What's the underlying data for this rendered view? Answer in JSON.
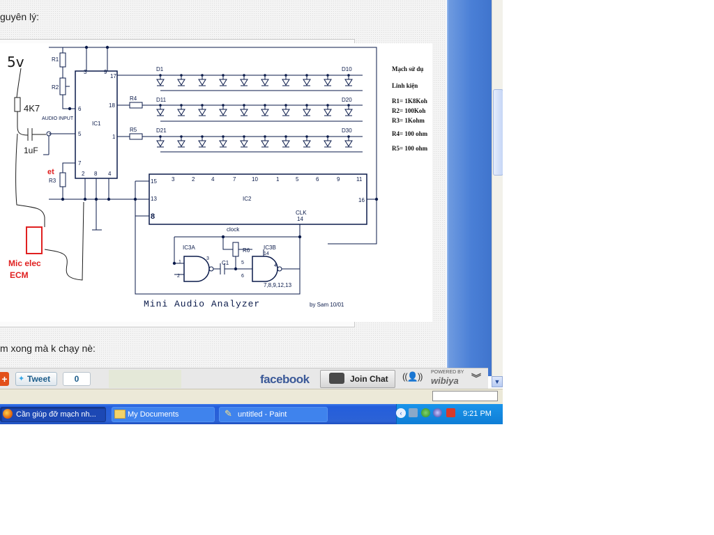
{
  "post": {
    "line1": "guyên lý:",
    "line2": "m xong mà k chạy nè:"
  },
  "schematic": {
    "title": "Mini Audio Analyzer",
    "credit": "by Sam 10/01",
    "ic1": "IC1",
    "ic2": "IC2",
    "ic3a": "IC3A",
    "ic3b": "IC3B",
    "clock_label": "clock",
    "clk_label": "CLK",
    "audio_input": "AUDIO INPUT",
    "resistors": [
      "R1",
      "R2",
      "R3",
      "R4",
      "R5",
      "R6"
    ],
    "c1": "C1",
    "d1": "D1",
    "d10": "D10",
    "d11": "D11",
    "d20": "D20",
    "d21": "D21",
    "d30": "D30",
    "ic1_pins": [
      "3",
      "9",
      "17",
      "6",
      "18",
      "5",
      "1",
      "7",
      "2",
      "8",
      "4"
    ],
    "ic2_pins_top": [
      "3",
      "2",
      "4",
      "7",
      "10",
      "1",
      "5",
      "6",
      "9",
      "11"
    ],
    "ic2_pins_left": [
      "15",
      "13",
      "8"
    ],
    "ic2_pin_right": "16",
    "ic2_pin_clk": "14",
    "ic3_pins": [
      "1",
      "2",
      "3",
      "5",
      "6",
      "4",
      "14",
      "7,8,9,12,13"
    ],
    "hand_5v": "5v",
    "hand_4k7": "4K7",
    "hand_1uf": "1uF",
    "hand_mic_1": "Mic elec",
    "hand_mic_2": "ECM",
    "hand_et": "et"
  },
  "side_notes": {
    "heading": "Mạch sử dụ",
    "parts": "Linh kiện",
    "r1": "R1= 1K8Koh",
    "r2": "R2= 100Koh",
    "r3": "R3= 1Kohm",
    "r4": "R4= 100 ohm",
    "r5": "R5= 100 ohm"
  },
  "share_bar": {
    "tweet": "Tweet",
    "tweet_count": "0",
    "facebook": "facebook",
    "join_chat": "Join Chat",
    "powered_by": "POWERED BY",
    "wibiya": "wibiya"
  },
  "taskbar": {
    "browser_task": "Cần giúp đỡ mạch nh...",
    "docs_task": "My Documents",
    "paint_task": "untitled - Paint",
    "clock": "9:21 PM"
  },
  "colors": {
    "taskbar_blue": "#245edb",
    "facebook_blue": "#3b5998",
    "annotation_red": "#e02020",
    "schematic_ink": "#0a1a4a"
  }
}
